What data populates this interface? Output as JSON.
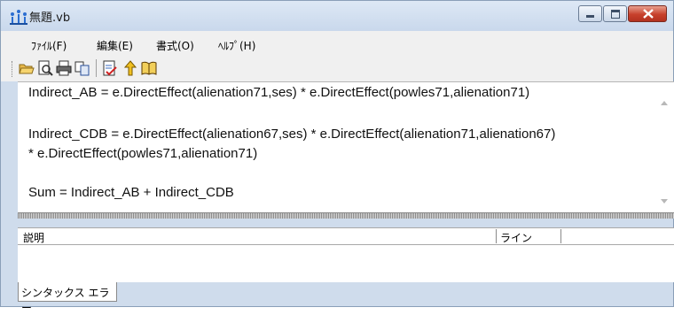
{
  "window": {
    "title": "無題.vb"
  },
  "menu": [
    "ﾌｧｲﾙ(F)",
    "編集(E)",
    "書式(O)",
    "ﾍﾙﾌﾟ(H)"
  ],
  "toolbar": {
    "icons": [
      "open-folder",
      "print-preview",
      "print",
      "copy",
      "run",
      "help-arrow",
      "book"
    ]
  },
  "editor": {
    "lines": [
      "Indirect_AB = e.DirectEffect(alienation71,ses) * e.DirectEffect(powles71,alienation71)",
      "Indirect_CDB = e.DirectEffect(alienation67,ses) * e.DirectEffect(alienation71,alienation67)",
      "* e.DirectEffect(powles71,alienation71)",
      "Sum = Indirect_AB + Indirect_CDB"
    ]
  },
  "panel": {
    "col_description": "説明",
    "col_line": "ライン",
    "tab_label": "シンタックス エラー"
  },
  "colors": {
    "close": "#c7402c",
    "frame": "#cfdcec"
  }
}
